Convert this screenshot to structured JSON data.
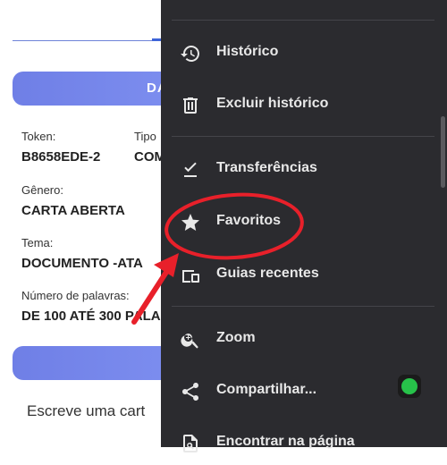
{
  "page": {
    "button_top_label": "DA",
    "fields": [
      {
        "label": "Token:",
        "value": "B8658EDE-2"
      },
      {
        "label": "Gênero:",
        "value": "CARTA ABERTA"
      },
      {
        "label": "Tema:",
        "value": "DOCUMENTO -ATA"
      },
      {
        "label": "Número de palavras:",
        "value": "DE 100 ATÉ 300 PALA"
      }
    ],
    "tipo_label": "Tipo",
    "tipo_value": "COM",
    "bottom_text": "Escreve uma cart"
  },
  "menu": {
    "items": [
      {
        "label": "Histórico",
        "icon": "history-icon"
      },
      {
        "label": "Excluir histórico",
        "icon": "trash-icon"
      },
      {
        "label": "Transferências",
        "icon": "download-check-icon"
      },
      {
        "label": "Favoritos",
        "icon": "star-icon"
      },
      {
        "label": "Guias recentes",
        "icon": "devices-icon"
      },
      {
        "label": "Zoom",
        "icon": "zoom-in-icon"
      },
      {
        "label": "Compartilhar...",
        "icon": "share-icon"
      },
      {
        "label": "Encontrar na página",
        "icon": "find-in-page-icon"
      }
    ],
    "badge_icon": "whatsapp-icon"
  },
  "colors": {
    "menu_bg": "#2b2b2f",
    "menu_text": "#e8e8e8",
    "button_gradient_start": "#6f7fe6",
    "button_gradient_end": "#7e8ff0",
    "annotation": "#e8202a",
    "whatsapp_green": "#27c24a"
  }
}
